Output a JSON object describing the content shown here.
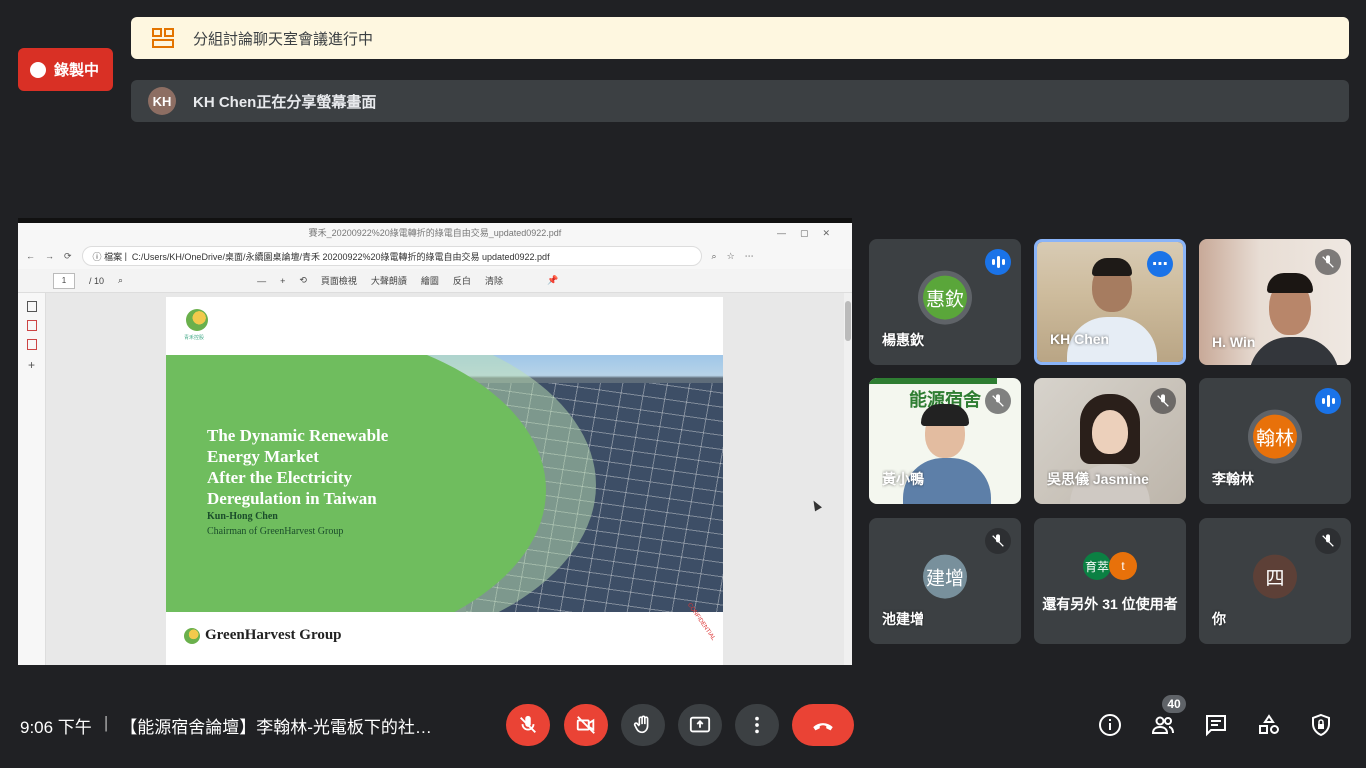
{
  "recording": {
    "label": "錄製中"
  },
  "banners": {
    "breakout": "分組討論聊天室會議進行中",
    "presenter_initials": "KH",
    "sharing": "KH Chen正在分享螢幕畫面"
  },
  "shared_screen": {
    "window_title": "賽禾_20200922%20綠電轉折的綠電自由交易_updated0922.pdf",
    "address_label": "檔案",
    "address": "C:/Users/KH/OneDrive/桌面/永續園桌論壇/青禾 20200922%20綠電轉折的綠電自由交易 updated0922.pdf",
    "page_number": "1",
    "page_total": "/ 10",
    "toolbar": [
      "頁面檢視",
      "大聲朗讀",
      "繪圖",
      "反白",
      "清除"
    ],
    "slide": {
      "logo_caption": "青禾控股",
      "title": "The Dynamic Renewable\nEnergy Market\nAfter the Electricity\nDeregulation in Taiwan",
      "author": "Kun-Hong Chen",
      "role": "Chairman of GreenHarvest Group",
      "footer": "GreenHarvest Group",
      "stamp": "CONFIDENTIAL"
    }
  },
  "participants": [
    {
      "name": "楊惠欽",
      "avatar": "惠欽",
      "avatar_color": "#5aa63a",
      "state": "speaking"
    },
    {
      "name": "KH Chen",
      "state": "active-video"
    },
    {
      "name": "H. Win",
      "state": "muted-video"
    },
    {
      "name": "黃小鴨",
      "state": "muted-video",
      "bg_text": "能源宿舍"
    },
    {
      "name": "吳思儀 Jasmine",
      "state": "muted-video"
    },
    {
      "name": "李翰林",
      "avatar": "翰林",
      "avatar_color": "#e8710a",
      "state": "speaking"
    },
    {
      "name": "池建增",
      "avatar": "建增",
      "avatar_color": "#78909c",
      "state": "muted"
    },
    {
      "name": "還有另外 31 位使用者",
      "mini1": "育萃",
      "mini1_color": "#0b8043",
      "mini2": "t",
      "mini2_color": "#e8710a"
    },
    {
      "name": "你",
      "avatar": "四",
      "avatar_color": "#5d4037",
      "state": "muted"
    }
  ],
  "bottom": {
    "time": "9:06 下午",
    "separator": "|",
    "meeting_title": "【能源宿舍論壇】李翰林-光電板下的社…",
    "people_count": "40"
  }
}
